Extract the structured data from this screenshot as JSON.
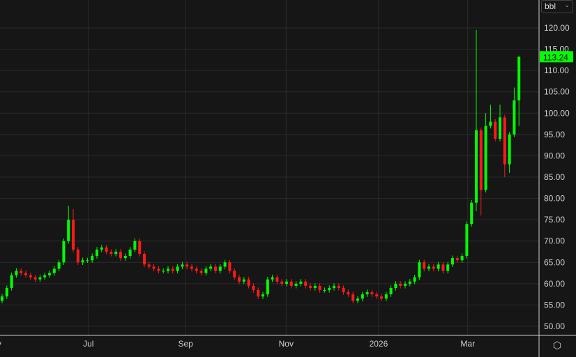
{
  "chart_data": {
    "type": "candlestick",
    "unit_selector": "bbl",
    "last_price": "113.24",
    "ylim": [
      48,
      124
    ],
    "yticks": [
      "50.00",
      "55.00",
      "60.00",
      "65.00",
      "70.00",
      "75.00",
      "80.00",
      "85.00",
      "90.00",
      "95.00",
      "100.00",
      "105.00",
      "110.00",
      "115.00",
      "120.00"
    ],
    "xticks": [
      {
        "label": "y",
        "index": -0.6
      },
      {
        "label": "Jul",
        "index": 18.2
      },
      {
        "label": "Sep",
        "index": 38.7
      },
      {
        "label": "Nov",
        "index": 59.9
      },
      {
        "label": "2026",
        "index": 79.4
      },
      {
        "label": "Mar",
        "index": 98.2
      }
    ],
    "open_first": 56,
    "closes": [
      57,
      59,
      62,
      63,
      62.5,
      62,
      61.5,
      61,
      61.5,
      62,
      62.5,
      63.5,
      65,
      70,
      75,
      68,
      65,
      65.5,
      65.5,
      66.5,
      68,
      68.5,
      67.5,
      67,
      67.5,
      66,
      66.5,
      68,
      70,
      67,
      64.5,
      64,
      63.5,
      63,
      63,
      63.5,
      63,
      64,
      64.5,
      64,
      63.5,
      63,
      62.5,
      63.5,
      64,
      63,
      64,
      65,
      63,
      61.5,
      60.5,
      61,
      59.5,
      58.5,
      57,
      57.5,
      61,
      61.5,
      60.5,
      60,
      60.5,
      59.5,
      60,
      60.5,
      59.5,
      59,
      59.5,
      58.5,
      58.5,
      59,
      59.5,
      59,
      58,
      57.5,
      56,
      56.5,
      57.5,
      58,
      57.5,
      57,
      56.5,
      57.5,
      59,
      60,
      59.5,
      60,
      60.5,
      61.5,
      65,
      63.5,
      64,
      63.5,
      64.5,
      63,
      64.5,
      66,
      65.5,
      66.5,
      74,
      79,
      96,
      82,
      97,
      98,
      94,
      99,
      88,
      95,
      103,
      113.24
    ],
    "high_overrides": {
      "14": 78.3,
      "15": 77.5,
      "28": 70.6,
      "100": 119.5,
      "102": 100,
      "103": 102,
      "105": 102,
      "108": 106,
      "109": 113.3
    },
    "low_overrides": {
      "100": 77,
      "101": 76,
      "106": 85,
      "107": 86,
      "109": 97
    }
  },
  "colors": {
    "up": "#00ff00",
    "down": "#ff1a1a",
    "grid": "#2b2b2b",
    "text": "#d0d0d0"
  },
  "settings_icon": "gear-icon"
}
